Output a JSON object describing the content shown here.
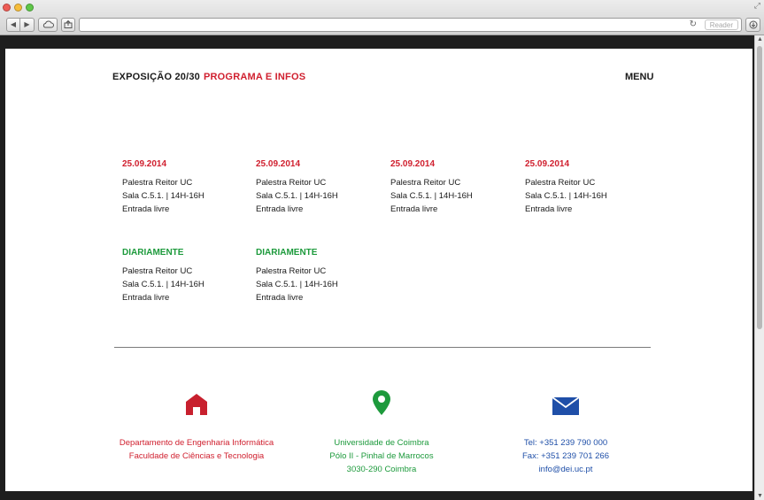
{
  "browser": {
    "reader_label": "Reader"
  },
  "header": {
    "title": "EXPOSIÇÃO 20/30",
    "subtitle": "PROGRAMA E INFOS",
    "menu_label": "MENU"
  },
  "events": [
    {
      "date": "25.09.2014",
      "line1": "Palestra Reitor UC",
      "line2": "Sala C.5.1. | 14H-16H",
      "line3": "Entrada livre"
    },
    {
      "date": "25.09.2014",
      "line1": "Palestra Reitor UC",
      "line2": "Sala C.5.1. | 14H-16H",
      "line3": "Entrada livre"
    },
    {
      "date": "25.09.2014",
      "line1": "Palestra Reitor UC",
      "line2": "Sala C.5.1. | 14H-16H",
      "line3": "Entrada livre"
    },
    {
      "date": "25.09.2014",
      "line1": "Palestra Reitor UC",
      "line2": "Sala C.5.1. | 14H-16H",
      "line3": "Entrada livre"
    },
    {
      "date": "DIARIAMENTE",
      "line1": "Palestra Reitor UC",
      "line2": "Sala C.5.1. | 14H-16H",
      "line3": "Entrada livre"
    },
    {
      "date": "DIARIAMENTE",
      "line1": "Palestra Reitor UC",
      "line2": "Sala C.5.1. | 14H-16H",
      "line3": "Entrada livre"
    }
  ],
  "footer": {
    "department": {
      "line1": "Departamento de Engenharia Informática",
      "line2": "Faculdade de Ciências e Tecnologia",
      "color": "#d0202f"
    },
    "address": {
      "line1": "Universidade de Coimbra",
      "line2": "Pólo II - Pinhal de Marrocos",
      "line3": "3030-290 Coimbra",
      "color": "#1d9a3c"
    },
    "contact": {
      "tel": "Tel: +351 239 790 000",
      "fax": "Fax: +351 239 701 266",
      "email": "info@dei.uc.pt",
      "color": "#1f4fa8"
    }
  },
  "colors": {
    "accent_red": "#d0202f",
    "accent_green": "#1d9a3c",
    "accent_blue": "#1f4fa8"
  },
  "icons": [
    "home-icon",
    "map-pin-icon",
    "mail-icon"
  ]
}
